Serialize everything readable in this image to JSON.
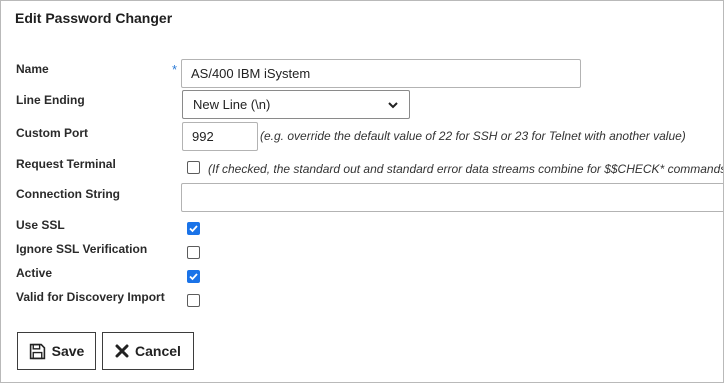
{
  "panel": {
    "title": "Edit Password Changer"
  },
  "form": {
    "name": {
      "label": "Name",
      "required_mark": "*",
      "value": "AS/400 IBM iSystem"
    },
    "line_ending": {
      "label": "Line Ending",
      "selected": "New Line (\\n)"
    },
    "custom_port": {
      "label": "Custom Port",
      "value": "992",
      "hint": "(e.g. override the default value of 22 for SSH or 23 for Telnet with another value)"
    },
    "request_terminal": {
      "label": "Request Terminal",
      "checked": false,
      "hint": "(If checked, the standard out and standard error data streams combine for $$CHECK* commands)"
    },
    "connection_string": {
      "label": "Connection String",
      "value": ""
    },
    "use_ssl": {
      "label": "Use SSL",
      "checked": true
    },
    "ignore_ssl_verification": {
      "label": "Ignore SSL Verification",
      "checked": false
    },
    "active": {
      "label": "Active",
      "checked": true
    },
    "valid_for_discovery_import": {
      "label": "Valid for Discovery Import",
      "checked": false
    }
  },
  "buttons": {
    "save": {
      "label": "Save",
      "icon": "floppy-disk-icon"
    },
    "cancel": {
      "label": "Cancel",
      "icon": "x-icon"
    }
  },
  "colors": {
    "accent": "#1a73e8",
    "required": "#2b7ad6",
    "border": "#b3b3b3"
  }
}
